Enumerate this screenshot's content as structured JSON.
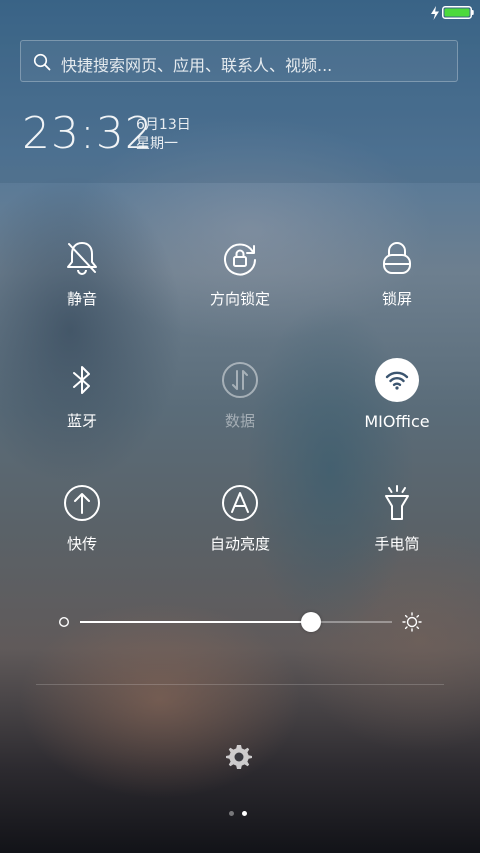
{
  "status_bar": {
    "charging": true,
    "battery_color": "#4cd93c"
  },
  "search": {
    "placeholder": "快捷搜索网页、应用、联系人、视频..."
  },
  "clock": {
    "time": "23:32",
    "date": "6月13日",
    "weekday": "星期一"
  },
  "toggles": [
    {
      "id": "mute",
      "label": "静音",
      "icon": "bell-off-icon",
      "active": false
    },
    {
      "id": "rotation-lock",
      "label": "方向锁定",
      "icon": "rotation-lock-icon",
      "active": false
    },
    {
      "id": "lock-screen",
      "label": "锁屏",
      "icon": "lock-icon",
      "active": false
    },
    {
      "id": "bluetooth",
      "label": "蓝牙",
      "icon": "bluetooth-icon",
      "active": false
    },
    {
      "id": "mobile-data",
      "label": "数据",
      "icon": "data-icon",
      "active": false,
      "disabled": true
    },
    {
      "id": "wifi",
      "label": "MIOffice",
      "icon": "wifi-icon",
      "active": true
    },
    {
      "id": "quick-transfer",
      "label": "快传",
      "icon": "upload-icon",
      "active": false
    },
    {
      "id": "auto-brightness",
      "label": "自动亮度",
      "icon": "auto-brightness-icon",
      "active": false
    },
    {
      "id": "flashlight",
      "label": "手电筒",
      "icon": "flashlight-icon",
      "active": false
    }
  ],
  "brightness": {
    "level": 0.74
  },
  "pager": {
    "pages": 2,
    "current": 2
  }
}
